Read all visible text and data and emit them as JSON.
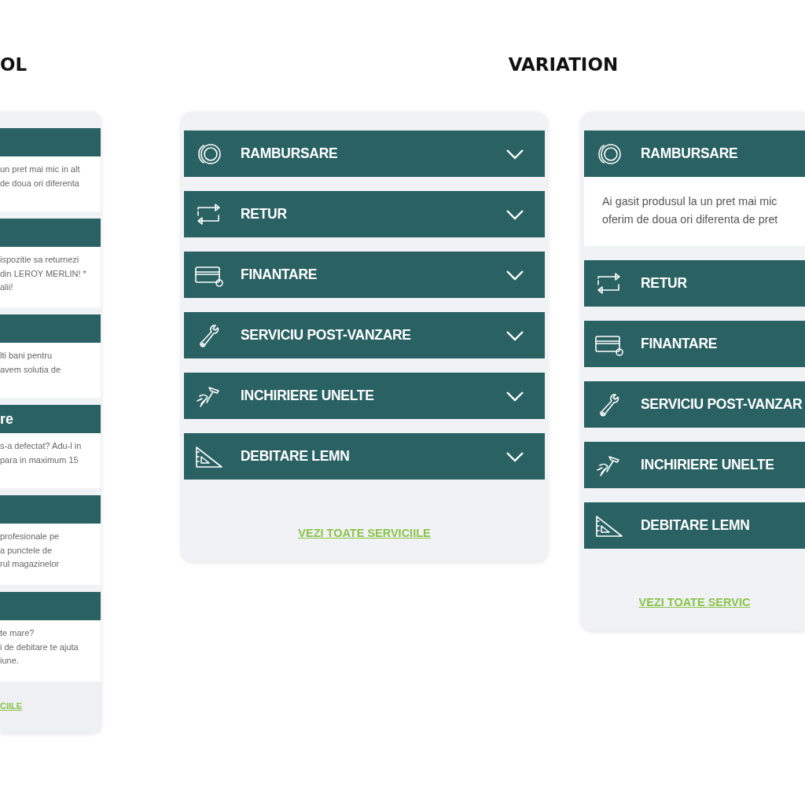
{
  "columns": [
    {
      "heading": "OL",
      "panel": {
        "kind": "compact",
        "items": [
          {
            "body": "un pret mai mic in alt\nde doua ori diferenta"
          },
          {
            "body": "ispozitie sa returnezi\ndin LEROY MERLIN! *\nalii!"
          },
          {
            "body": "lti bani pentru\navem solutia de"
          },
          {
            "title": "re",
            "body": "s-a defectat? Adu-l in\npara in maximum 15"
          },
          {
            "body": "profesionale pe\na punctele de\nrul magazinelor"
          },
          {
            "body": "te mare?\ni de debitare te ajuta\niune."
          }
        ],
        "link": "CIILE"
      }
    },
    {
      "heading": "VARIATION",
      "panels": [
        {
          "kind": "full",
          "items": [
            {
              "title": "RAMBURSARE",
              "expanded": false
            },
            {
              "title": "RETUR",
              "expanded": false
            },
            {
              "title": "FINANTARE",
              "expanded": false
            },
            {
              "title": "SERVICIU POST-VANZARE",
              "expanded": false
            },
            {
              "title": "INCHIRIERE UNELTE",
              "expanded": false
            },
            {
              "title": "DEBITARE LEMN",
              "expanded": false
            }
          ],
          "link": "VEZI TOATE SERVICIILE"
        },
        {
          "kind": "full",
          "items": [
            {
              "title": "RAMBURSARE",
              "body": "Ai gasit produsul la un pret mai mic\noferim de doua ori diferenta de pret"
            },
            {
              "title": "RETUR"
            },
            {
              "title": "FINANTARE"
            },
            {
              "title": "SERVICIU POST-VANZAR"
            },
            {
              "title": "INCHIRIERE UNELTE"
            },
            {
              "title": "DEBITARE LEMN"
            }
          ],
          "link": "VEZI TOATE SERVIC"
        }
      ]
    }
  ]
}
